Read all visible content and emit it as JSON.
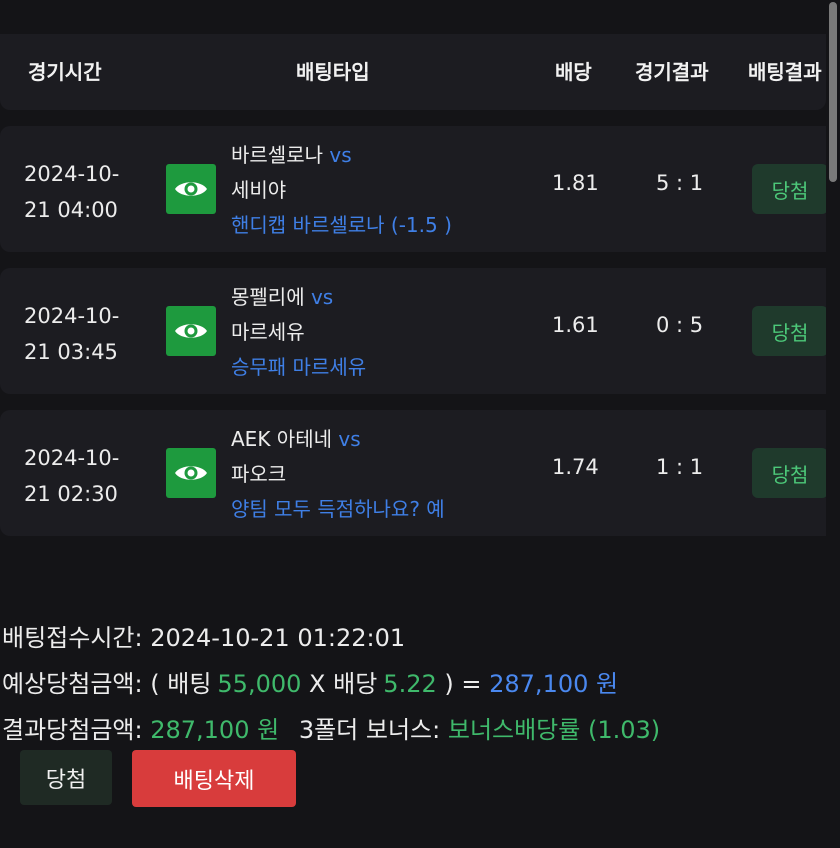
{
  "header": {
    "col_time": "경기시간",
    "col_type": "배팅타입",
    "col_odds": "배당",
    "col_match_result": "경기결과",
    "col_bet_result": "배팅결과"
  },
  "vs_label": "vs",
  "rows": [
    {
      "date_line1": "2024-10-",
      "date_line2": "21 04:00",
      "home": "바르셀로나",
      "away": "세비야",
      "market": "핸디캡 바르셀로나 (-1.5 )",
      "odds": "1.81",
      "score": "5 : 1",
      "result": "당첨"
    },
    {
      "date_line1": "2024-10-",
      "date_line2": "21 03:45",
      "home": "몽펠리에",
      "away": "마르세유",
      "market": "승무패 마르세유",
      "odds": "1.61",
      "score": "0 : 5",
      "result": "당첨"
    },
    {
      "date_line1": "2024-10-",
      "date_line2": "21 02:30",
      "home": "AEK 아테네",
      "away": "파오크",
      "market": "양팀 모두 득점하나요? 예",
      "odds": "1.74",
      "score": "1 : 1",
      "result": "당첨"
    }
  ],
  "summary": {
    "bet_time_label": "배팅접수시간:",
    "bet_time_value": "2024-10-21 01:22:01",
    "expected_label": "예상당첨금액:",
    "paren_open": "(",
    "bet_word": "배팅",
    "bet_amount": "55,000",
    "times": "X",
    "odds_word": "배당",
    "total_odds": "5.22",
    "paren_close_eq": ") =",
    "expected_amount": "287,100 원",
    "result_label": "결과당첨금액:",
    "result_amount": "287,100 원",
    "bonus_label": "3폴더 보너스:",
    "bonus_value": "보너스배당률 (1.03)"
  },
  "buttons": {
    "win": "당첨",
    "delete": "배팅삭제"
  },
  "colors": {
    "background": "#141417",
    "row_bg": "#1c1c21",
    "eye_button": "#1e9a3e",
    "win_badge_text": "#4cc879",
    "link_blue": "#3f7fe6",
    "amount_green": "#3fb96b",
    "delete_button": "#d83c3c"
  },
  "icons": {
    "view": "eye-icon"
  }
}
